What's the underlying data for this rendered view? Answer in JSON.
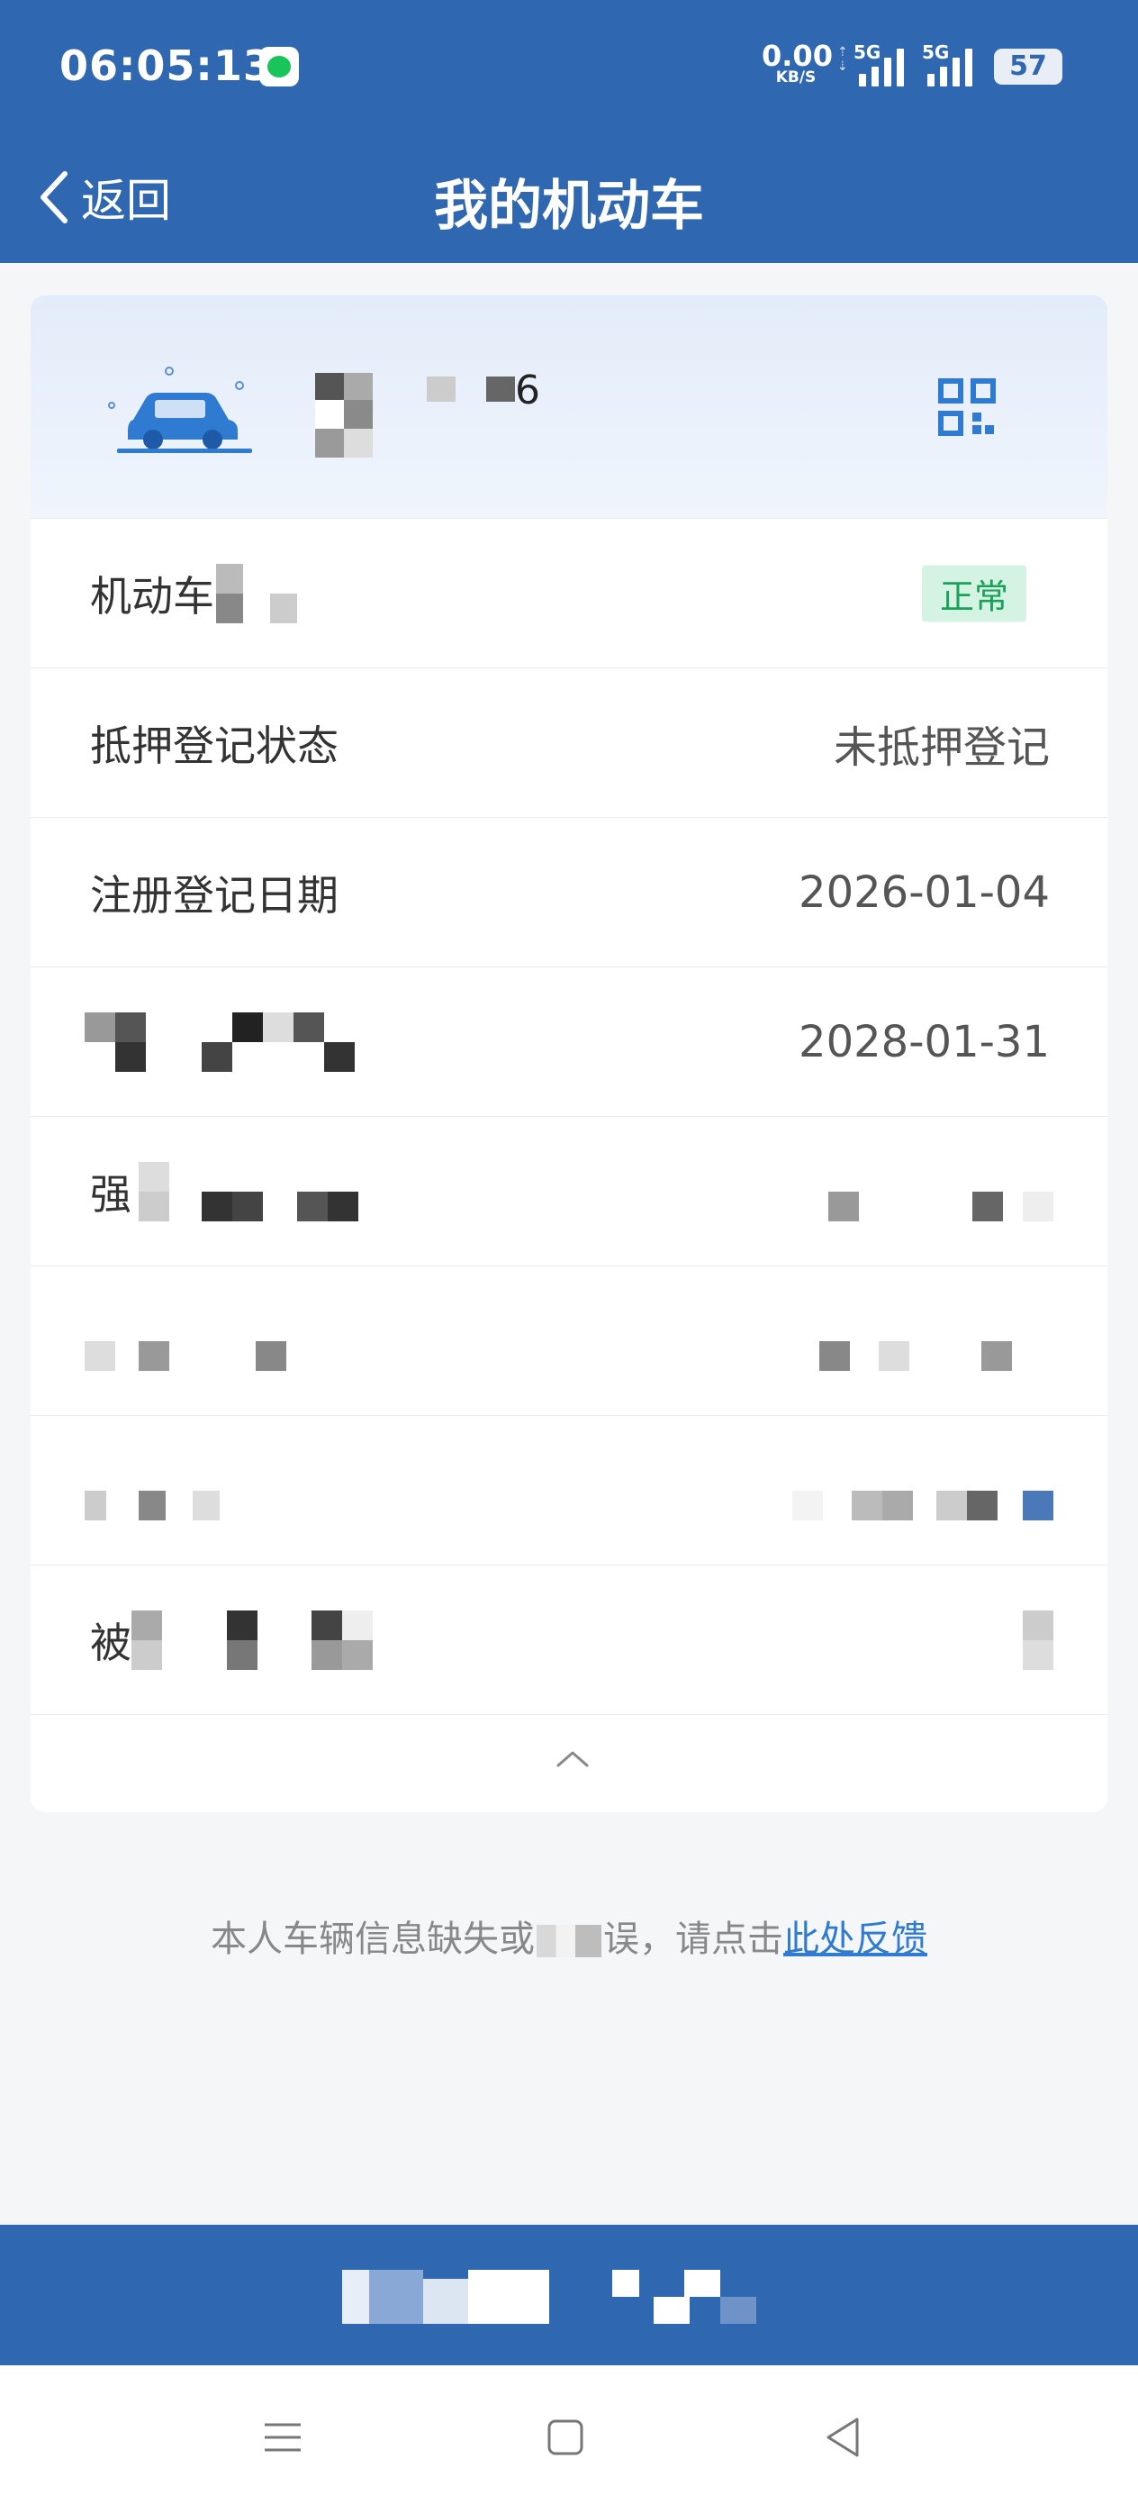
{
  "status_bar": {
    "time": "06:05:13",
    "net_speed": "0.00",
    "net_unit": "KB/S",
    "signal_1": "5G",
    "signal_2": "5G",
    "battery": "57"
  },
  "header": {
    "back_label": "返回",
    "title": "我的机动车"
  },
  "vehicle": {
    "plate_visible_char": "6"
  },
  "rows": [
    {
      "label": "机动车",
      "badge": "正常"
    },
    {
      "label": "抵押登记状态",
      "value": "未抵押登记"
    },
    {
      "label": "注册登记日期",
      "value": "2026-01-04"
    },
    {
      "label": "",
      "value": "2028-01-31"
    },
    {
      "label": "强",
      "value": ""
    },
    {
      "label": "",
      "value": ""
    },
    {
      "label": "",
      "value": ""
    },
    {
      "label": "被",
      "value": ""
    }
  ],
  "feedback": {
    "text_before": "本人车辆信息缺失或",
    "text_after": "误，请点击",
    "link": "此处反馈"
  },
  "colors": {
    "primary": "#2f67b0",
    "badge_bg": "#d4f3e3",
    "badge_text": "#1aa25a",
    "link": "#2f7bd2"
  },
  "icons": {
    "back": "chevron-left-icon",
    "vehicle": "car-icon",
    "qr": "qr-code-icon",
    "collapse": "chevron-up-icon",
    "nav_menu": "menu-icon",
    "nav_home": "home-square-icon",
    "nav_back": "back-triangle-icon"
  }
}
